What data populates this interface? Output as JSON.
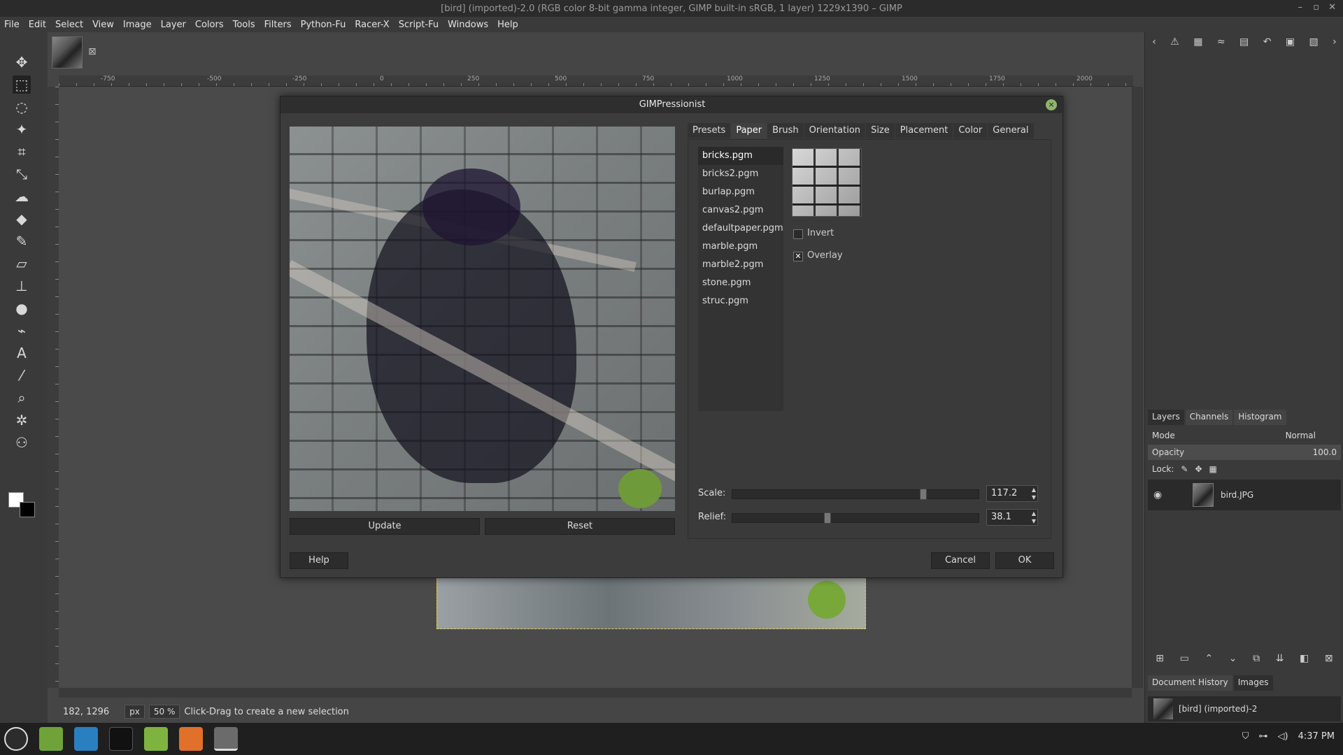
{
  "window": {
    "title": "[bird] (imported)-2.0 (RGB color 8-bit gamma integer, GIMP built-in sRGB, 1 layer) 1229x1390 – GIMP"
  },
  "menu": [
    "File",
    "Edit",
    "Select",
    "View",
    "Image",
    "Layer",
    "Colors",
    "Tools",
    "Filters",
    "Python-Fu",
    "Racer-X",
    "Script-Fu",
    "Windows",
    "Help"
  ],
  "ruler_labels": [
    "-750",
    "-500",
    "-250",
    "0",
    "250",
    "500",
    "750",
    "1000",
    "1250",
    "1500",
    "1750",
    "2000"
  ],
  "status": {
    "coords": "182, 1296",
    "unit": "px",
    "zoom": "50 %",
    "message": "Click-Drag to create a new selection"
  },
  "dialog": {
    "title": "GIMPressionist",
    "update_label": "Update",
    "reset_label": "Reset",
    "help_label": "Help",
    "cancel_label": "Cancel",
    "ok_label": "OK",
    "tabs": [
      "Presets",
      "Paper",
      "Brush",
      "Orientation",
      "Size",
      "Placement",
      "Color",
      "General"
    ],
    "active_tab": "Paper",
    "papers": [
      "bricks.pgm",
      "bricks2.pgm",
      "burlap.pgm",
      "canvas2.pgm",
      "defaultpaper.pgm",
      "marble.pgm",
      "marble2.pgm",
      "stone.pgm",
      "struc.pgm"
    ],
    "selected_paper": "bricks.pgm",
    "invert_label": "Invert",
    "invert_checked": false,
    "overlay_label": "Overlay",
    "overlay_checked": true,
    "overlay_mark": "✕",
    "scale_label": "Scale:",
    "scale_value": "117.2",
    "scale_fraction": 0.78,
    "relief_label": "Relief:",
    "relief_value": "38.1",
    "relief_fraction": 0.38
  },
  "dock": {
    "tabs": [
      "Layers",
      "Channels",
      "Histogram"
    ],
    "mode_label": "Mode",
    "mode_value": "Normal",
    "opacity_label": "Opacity",
    "opacity_value": "100.0",
    "lock_label": "Lock:",
    "layer_name": "bird.JPG",
    "tabs2": [
      "Document History",
      "Images"
    ],
    "image_name": "[bird] (imported)-2"
  },
  "taskbar": {
    "clock": "4:37 PM"
  },
  "colors": {
    "accent_green": "#8fb56b",
    "selection_marching": "#e8d14a"
  }
}
